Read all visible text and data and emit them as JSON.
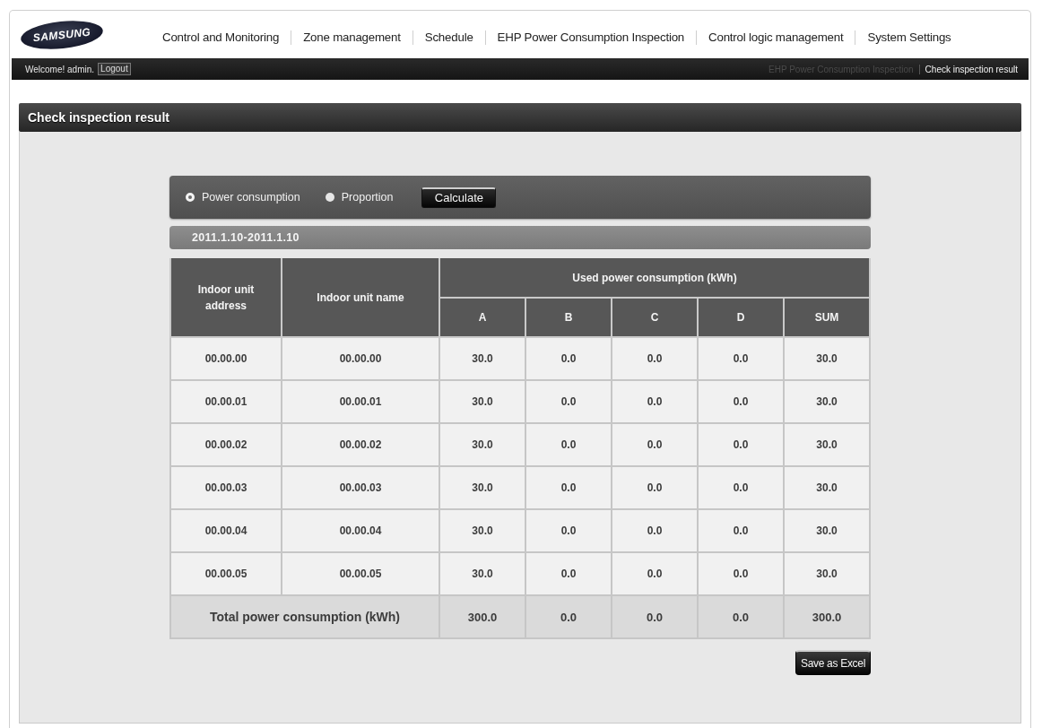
{
  "header": {
    "logo": "SAMSUNG",
    "nav": [
      {
        "label": "Control and Monitoring"
      },
      {
        "label": "Zone management"
      },
      {
        "label": "Schedule"
      },
      {
        "label": "EHP Power Consumption Inspection"
      },
      {
        "label": "Control logic management"
      },
      {
        "label": "System Settings"
      }
    ]
  },
  "user_bar": {
    "welcome": "Welcome! admin.",
    "logout": "Logout",
    "breadcrumb": [
      {
        "label": "EHP Power Consumption Inspection",
        "current": false
      },
      {
        "label": "Check inspection result",
        "current": true
      }
    ]
  },
  "page_title": "Check inspection result",
  "options": {
    "items": [
      {
        "label": "Power consumption",
        "selected": true
      },
      {
        "label": "Proportion",
        "selected": false
      }
    ],
    "calculate_button": "Calculate"
  },
  "date_range": "2011.1.10-2011.1.10",
  "table": {
    "columns": [
      "Indoor unit address",
      "Indoor unit name"
    ],
    "group": {
      "label": "Used power consumption (kWh)",
      "columns": [
        "A",
        "B",
        "C",
        "D",
        "SUM"
      ]
    },
    "rows": [
      {
        "address": "00.00.00",
        "name": "00.00.00",
        "values": [
          "30.0",
          "0.0",
          "0.0",
          "0.0",
          "30.0"
        ]
      },
      {
        "address": "00.00.01",
        "name": "00.00.01",
        "values": [
          "30.0",
          "0.0",
          "0.0",
          "0.0",
          "30.0"
        ]
      },
      {
        "address": "00.00.02",
        "name": "00.00.02",
        "values": [
          "30.0",
          "0.0",
          "0.0",
          "0.0",
          "30.0"
        ]
      },
      {
        "address": "00.00.03",
        "name": "00.00.03",
        "values": [
          "30.0",
          "0.0",
          "0.0",
          "0.0",
          "30.0"
        ]
      },
      {
        "address": "00.00.04",
        "name": "00.00.04",
        "values": [
          "30.0",
          "0.0",
          "0.0",
          "0.0",
          "30.0"
        ]
      },
      {
        "address": "00.00.05",
        "name": "00.00.05",
        "values": [
          "30.0",
          "0.0",
          "0.0",
          "0.0",
          "30.0"
        ]
      }
    ],
    "total": {
      "label": "Total power consumption (kWh)",
      "values": [
        "300.0",
        "0.0",
        "0.0",
        "0.0",
        "300.0"
      ]
    }
  },
  "save_button": "Save as Excel"
}
